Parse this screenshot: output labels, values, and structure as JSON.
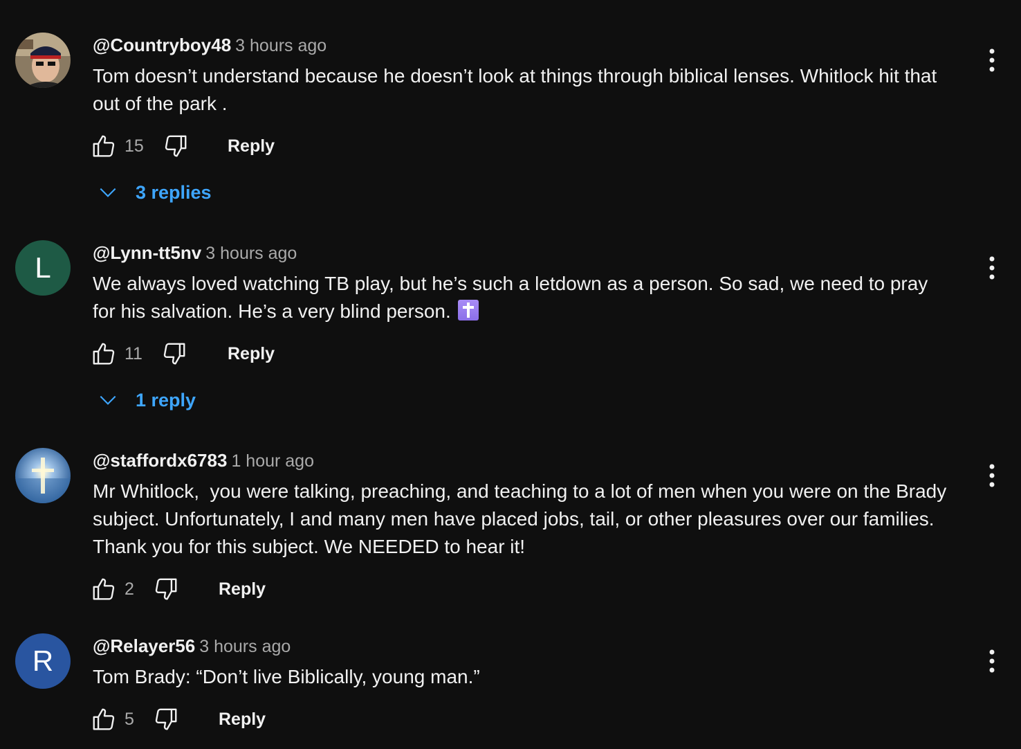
{
  "comments": [
    {
      "author": "@Countryboy48",
      "time": "3 hours ago",
      "text": "Tom doesn’t understand because he doesn’t look at things through biblical lenses. Whitlock hit that out of the park .",
      "likes": "15",
      "reply_label": "Reply",
      "replies_label": "3 replies",
      "avatar": "photo-man-cap"
    },
    {
      "author": "@Lynn-tt5nv",
      "time": "3 hours ago",
      "text": "We always loved watching TB play, but he’s such a letdown as a person. So sad, we need to pray for his salvation. He’s a very blind person.",
      "emoji": "latin-cross-emoji",
      "likes": "11",
      "reply_label": "Reply",
      "replies_label": "1 reply",
      "avatar_letter": "L",
      "avatar_color": "#1e5a45"
    },
    {
      "author": "@staffordx6783",
      "time": "1 hour ago",
      "text": "Mr Whitlock,  you were talking, preaching, and teaching to a lot of men when you were on the Brady subject. Unfortunately, I and many men have placed jobs, tail, or other pleasures over our families. Thank you for this subject. We NEEDED to hear it!",
      "likes": "2",
      "reply_label": "Reply",
      "avatar": "photo-sunset-cross"
    },
    {
      "author": "@Relayer56",
      "time": "3 hours ago",
      "text": "Tom Brady: “Don’t live Biblically, young man.”",
      "likes": "5",
      "reply_label": "Reply",
      "avatar_letter": "R",
      "avatar_color": "#2955a0"
    }
  ],
  "colors": {
    "background": "#0f0f0f",
    "text": "#f1f1f1",
    "secondary_text": "#aaaaaa",
    "link": "#3ea6ff"
  }
}
